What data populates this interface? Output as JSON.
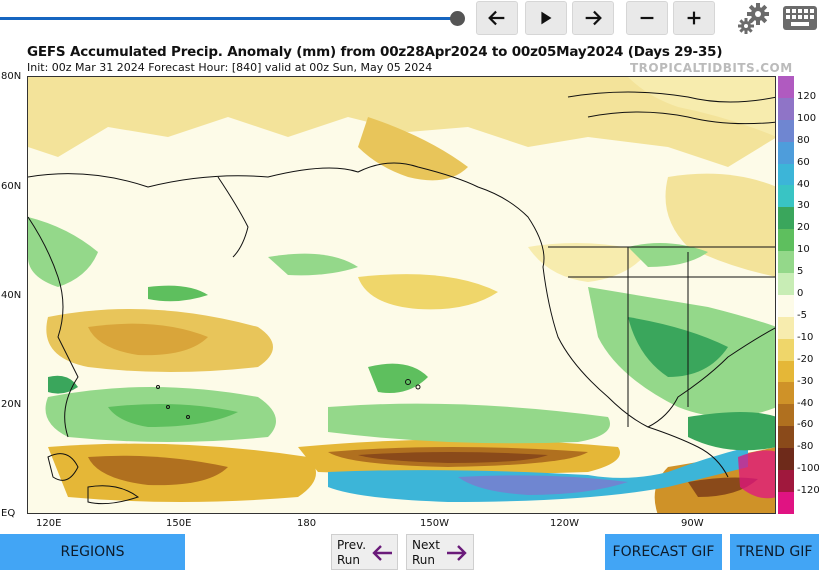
{
  "title": "GEFS Accumulated Precip. Anomaly (mm) from 00z28Apr2024 to 00z05May2024 (Days 29-35)",
  "subtitle": "Init: 00z Mar 31 2024   Forecast Hour: [840]   valid at 00z Sun, May 05 2024",
  "site": "TROPICALTIDBITS.COM",
  "lat_labels": [
    "80N",
    "60N",
    "40N",
    "20N",
    "EQ"
  ],
  "lon_labels": [
    "120E",
    "150E",
    "180",
    "150W",
    "120W",
    "90W"
  ],
  "colorbar": {
    "labels": [
      "120",
      "100",
      "80",
      "60",
      "40",
      "30",
      "20",
      "10",
      "5",
      "0",
      "-5",
      "-10",
      "-20",
      "-30",
      "-40",
      "-60",
      "-80",
      "-100",
      "-120"
    ],
    "colors": [
      "#b05ac0",
      "#8f74c7",
      "#6f86d1",
      "#4e9ddb",
      "#3cb5d8",
      "#39c4c4",
      "#3aa65c",
      "#5ebf5e",
      "#94d88a",
      "#c8edb5",
      "#fdfbe8",
      "#f7ecae",
      "#efd66a",
      "#e5b737",
      "#cf9228",
      "#b0701f",
      "#8a4a1a",
      "#6e2a1a",
      "#a0183d",
      "#e01382"
    ]
  },
  "toolbar": {
    "back_icon": "arrow-left-icon",
    "play_icon": "play-icon",
    "forward_icon": "arrow-right-icon",
    "zoom_out_icon": "minus-icon",
    "zoom_in_icon": "plus-icon",
    "settings_icon": "gear-icon",
    "keyboard_icon": "keyboard-icon"
  },
  "buttons": {
    "regions": "REGIONS",
    "prev_run_1": "Prev.",
    "prev_run_2": "Run",
    "next_run_1": "Next",
    "next_run_2": "Run",
    "forecast_gif": "FORECAST GIF",
    "trend_gif": "TREND GIF"
  },
  "colors": {
    "accent": "#42a5f5",
    "slider": "#1565c0",
    "run_arrow": "#6a1b7a"
  }
}
